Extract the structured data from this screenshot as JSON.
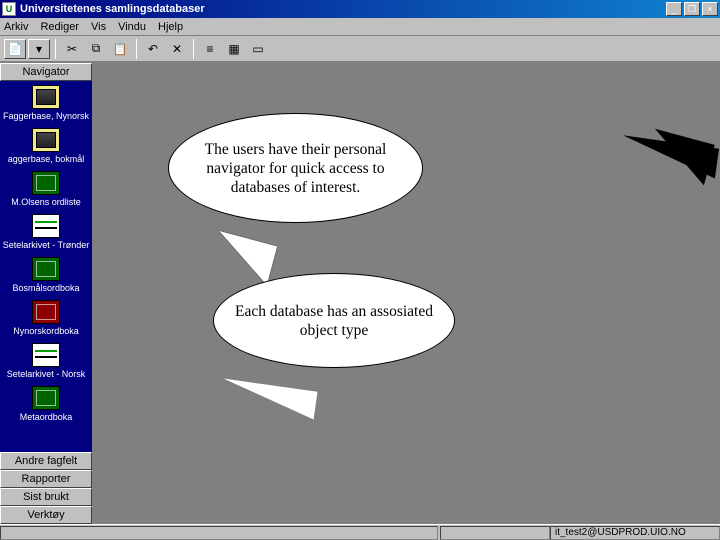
{
  "window": {
    "title": "Universitetenes samlingsdatabaser",
    "minimize": "_",
    "restore": "❐",
    "close": "×"
  },
  "menu": {
    "arkiv": "Arkiv",
    "rediger": "Rediger",
    "vis": "Vis",
    "vindu": "Vindu",
    "hjelp": "Hjelp"
  },
  "sidebar": {
    "header": "Navigator",
    "items": [
      {
        "label": "Faggerbase, Nynorsk"
      },
      {
        "label": "aggerbase, bokmål"
      },
      {
        "label": "M.Olsens ordliste"
      },
      {
        "label": "Setelarkivet - Trønder"
      },
      {
        "label": "Bosmålsordboka"
      },
      {
        "label": "Nynorskordboka"
      },
      {
        "label": "Setelarkivet - Norsk"
      },
      {
        "label": "Metaordboka"
      }
    ],
    "footer": {
      "andre": "Andre fagfelt",
      "rapporter": "Rapporter",
      "sist": "Sist brukt",
      "verktoy": "Verktøy"
    }
  },
  "callouts": {
    "c1": "The users have their personal navigator for quick access to databases of interest.",
    "c2": "Each database has an assosiated object type"
  },
  "status": {
    "info": "it_test2@USDPROD.UIO.NO"
  }
}
